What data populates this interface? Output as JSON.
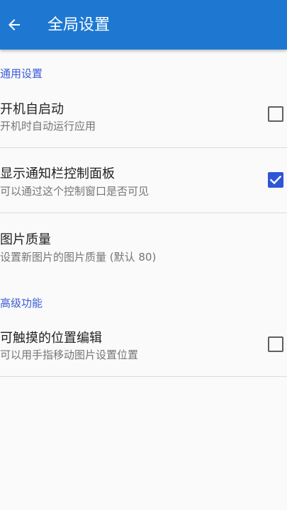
{
  "appbar": {
    "title": "全局设置",
    "back_icon": "arrow-left-icon",
    "color": "#1e78d2"
  },
  "sections": {
    "general": {
      "header": "通用设置"
    },
    "advanced": {
      "header": "高级功能"
    }
  },
  "prefs": {
    "autostart": {
      "title": "开机自启动",
      "summary": "开机时自动运行应用",
      "checked": false
    },
    "notification_panel": {
      "title": "显示通知栏控制面板",
      "summary": "可以通过这个控制窗口是否可见",
      "checked": true
    },
    "image_quality": {
      "title": "图片质量",
      "summary": "设置新图片的图片质量 (默认 80)"
    },
    "touch_edit": {
      "title": "可触摸的位置编辑",
      "summary": "可以用手指移动图片设置位置",
      "checked": false
    }
  },
  "colors": {
    "accent": "#2e55d6",
    "section_header": "#3a5bd8"
  }
}
